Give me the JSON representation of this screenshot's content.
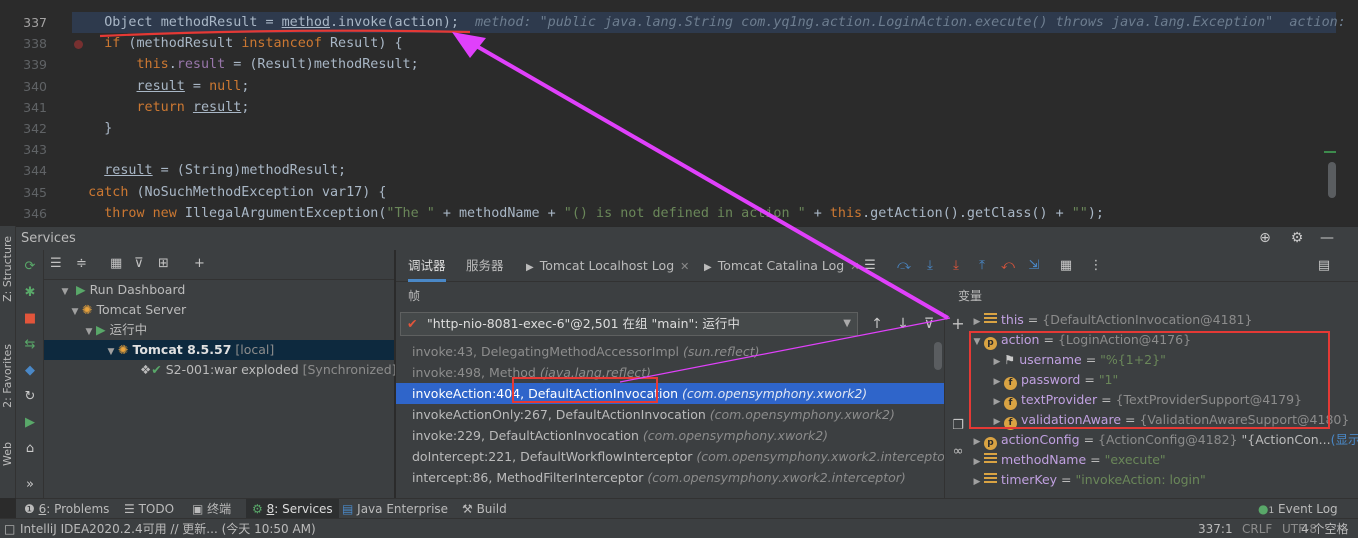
{
  "editor": {
    "line_numbers": [
      "337",
      "338",
      "339",
      "340",
      "341",
      "342",
      "343",
      "344",
      "345",
      "346"
    ],
    "inline_hint": "method: \"public java.lang.String com.yq1ng.action.LoginAction.execute() throws java.lang.Exception\"  action:"
  },
  "left_strip": {
    "structure": "Z: Structure",
    "favorites": "2: Favorites",
    "web": "Web"
  },
  "services": {
    "title": "Services",
    "tree": [
      {
        "label": "Run Dashboard"
      },
      {
        "label": "Tomcat Server"
      },
      {
        "label": "运行中"
      },
      {
        "label": "Tomcat 8.5.57",
        "suffix": "[local]"
      },
      {
        "label": "S2-001:war exploded",
        "suffix": "[Synchronized]"
      }
    ]
  },
  "debugger": {
    "tabs": [
      "调试器",
      "服务器",
      "Tomcat Localhost Log",
      "Tomcat Catalina Log"
    ],
    "frames_header": "帧",
    "variables_header": "变量",
    "thread": "\"http-nio-8081-exec-6\"@2,501 在组 \"main\": 运行中",
    "frames": [
      {
        "method": "invoke:43, DelegatingMethodAccessorImpl",
        "pkg": "(sun.reflect)"
      },
      {
        "method": "invoke:498, Method",
        "pkg": "(java.lang.reflect)"
      },
      {
        "method": "invokeAction:404, ",
        "cls": "DefaultActionInvocation",
        "pkg": "(com.opensymphony.xwork2)"
      },
      {
        "method": "invokeActionOnly:267, DefaultActionInvocation",
        "pkg": "(com.opensymphony.xwork2)"
      },
      {
        "method": "invoke:229, DefaultActionInvocation",
        "pkg": "(com.opensymphony.xwork2)"
      },
      {
        "method": "doIntercept:221, DefaultWorkflowInterceptor",
        "pkg": "(com.opensymphony.xwork2.interceptor)"
      },
      {
        "method": "intercept:86, MethodFilterInterceptor",
        "pkg": "(com.opensymphony.xwork2.interceptor)"
      }
    ],
    "variables": [
      {
        "name": "this",
        "value": "{DefaultActionInvocation@4181}"
      },
      {
        "name": "action",
        "value": "{LoginAction@4176}"
      },
      {
        "name": "username",
        "value": "\"%{1+2}\""
      },
      {
        "name": "password",
        "value": "\"1\""
      },
      {
        "name": "textProvider",
        "value": "{TextProviderSupport@4179}"
      },
      {
        "name": "validationAware",
        "value": "{ValidationAwareSupport@4180}"
      },
      {
        "name": "actionConfig",
        "value": "{ActionConfig@4182}",
        "extra": "\"{ActionCon...",
        "link": "(显示"
      },
      {
        "name": "methodName",
        "value": "\"execute\""
      },
      {
        "name": "timerKey",
        "value": "\"invokeAction: login\""
      }
    ]
  },
  "bottom_tabs": [
    {
      "num": "6",
      "label": ": Problems"
    },
    {
      "label": "TODO"
    },
    {
      "label": "终端"
    },
    {
      "num": "8",
      "label": ": Services"
    },
    {
      "label": "Java Enterprise"
    },
    {
      "label": "Build"
    },
    {
      "num": "1",
      "label": "Event Log"
    }
  ],
  "status": {
    "message": "IntelliJ IDEA2020.2.4可用 // 更新... (今天 10:50 AM)",
    "position": "337:1",
    "line_sep": "CRLF",
    "encoding": "UTF-8",
    "indent": "4 个空格"
  },
  "colors": {
    "annotation": "#e53935",
    "arrow": "#e040fb",
    "selection": "#2f65ca"
  }
}
